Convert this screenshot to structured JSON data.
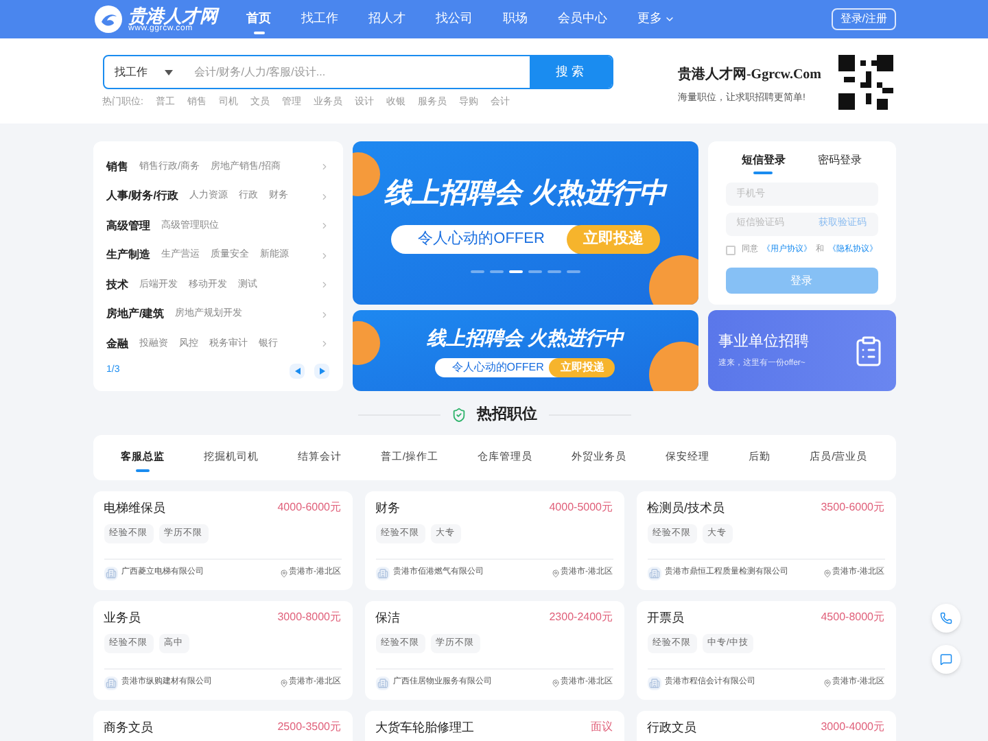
{
  "header": {
    "logo_name": "贵港人才网",
    "logo_url": "www.ggrcw.com",
    "nav": [
      {
        "label": "首页",
        "selected": true
      },
      {
        "label": "找工作",
        "selected": false
      },
      {
        "label": "招人才",
        "selected": false
      },
      {
        "label": "找公司",
        "selected": false
      },
      {
        "label": "职场",
        "selected": false
      },
      {
        "label": "会员中心",
        "selected": false
      },
      {
        "label": "更多",
        "selected": false,
        "dropdown": true
      }
    ],
    "login_button": "登录/注册"
  },
  "search": {
    "type_select": "找工作",
    "placeholder": "会计/财务/人力/客服/设计...",
    "button": "搜 索",
    "hot_label": "热门职位:",
    "hot": [
      "普工",
      "销售",
      "司机",
      "文员",
      "管理",
      "业务员",
      "设计",
      "收银",
      "服务员",
      "导购",
      "会计"
    ]
  },
  "brand": {
    "title": "贵港人才网-Ggrcw.Com",
    "slogan": "海量职位，让求职招聘更简单!"
  },
  "categories": {
    "items": [
      {
        "name": "销售",
        "subs": [
          "销售行政/商务",
          "房地产销售/招商"
        ]
      },
      {
        "name": "人事/财务/行政",
        "subs": [
          "人力资源",
          "行政",
          "财务"
        ]
      },
      {
        "name": "高级管理",
        "subs": [
          "高级管理职位"
        ]
      },
      {
        "name": "生产制造",
        "subs": [
          "生产营运",
          "质量安全",
          "新能源"
        ]
      },
      {
        "name": "技术",
        "subs": [
          "后端开发",
          "移动开发",
          "测试"
        ]
      },
      {
        "name": "房地产/建筑",
        "subs": [
          "房地产规划开发"
        ]
      },
      {
        "name": "金融",
        "subs": [
          "投融资",
          "风控",
          "税务审计",
          "银行"
        ]
      }
    ],
    "page": "1/3"
  },
  "banners": [
    {
      "headline": "线上招聘会 火热进行中",
      "tagline": "令人心动的OFFER",
      "cta": "立即投递",
      "dots": [
        {
          "selected": false
        },
        {
          "selected": false
        },
        {
          "selected": true
        },
        {
          "selected": false
        },
        {
          "selected": false
        },
        {
          "selected": false
        }
      ]
    },
    {
      "headline": "线上招聘会 火热进行中",
      "tagline": "令人心动的OFFER",
      "cta": "立即投递"
    }
  ],
  "login": {
    "tabs": [
      {
        "label": "短信登录",
        "selected": true
      },
      {
        "label": "密码登录",
        "selected": false
      }
    ],
    "phone_placeholder": "手机号",
    "code_placeholder": "短信验证码",
    "get_code": "获取验证码",
    "agree": {
      "checked": false,
      "prefix": "同意",
      "user_agreement": "《用户协议》",
      "and": "和",
      "privacy": "《隐私协议》"
    },
    "submit": "登录"
  },
  "promo": {
    "title": "事业单位招聘",
    "subtitle": "速来，这里有一份offer~"
  },
  "section_title": "热招职位",
  "job_tabs": [
    {
      "label": "客服总监",
      "selected": true
    },
    {
      "label": "挖掘机司机",
      "selected": false
    },
    {
      "label": "结算会计",
      "selected": false
    },
    {
      "label": "普工/操作工",
      "selected": false
    },
    {
      "label": "仓库管理员",
      "selected": false
    },
    {
      "label": "外贸业务员",
      "selected": false
    },
    {
      "label": "保安经理",
      "selected": false
    },
    {
      "label": "后勤",
      "selected": false
    },
    {
      "label": "店员/营业员",
      "selected": false
    }
  ],
  "jobs": [
    {
      "title": "电梯维保员",
      "salary": "4000-6000元",
      "tags": [
        "经验不限",
        "学历不限"
      ],
      "company": "广西菱立电梯有限公司",
      "location": "贵港市-港北区"
    },
    {
      "title": "财务",
      "salary": "4000-5000元",
      "tags": [
        "经验不限",
        "大专"
      ],
      "company": "贵港市佰港燃气有限公司",
      "location": "贵港市-港北区"
    },
    {
      "title": "检测员/技术员",
      "salary": "3500-6000元",
      "tags": [
        "经验不限",
        "大专"
      ],
      "company": "贵港市鼎恒工程质量检测有限公司",
      "location": "贵港市-港北区"
    },
    {
      "title": "业务员",
      "salary": "3000-8000元",
      "tags": [
        "经验不限",
        "高中"
      ],
      "company": "贵港市纵购建材有限公司",
      "location": "贵港市-港北区"
    },
    {
      "title": "保洁",
      "salary": "2300-2400元",
      "tags": [
        "经验不限",
        "学历不限"
      ],
      "company": "广西佳居物业服务有限公司",
      "location": "贵港市-港北区"
    },
    {
      "title": "开票员",
      "salary": "4500-8000元",
      "tags": [
        "经验不限",
        "中专/中技"
      ],
      "company": "贵港市程信会计有限公司",
      "location": "贵港市-港北区"
    },
    {
      "title": "商务文员",
      "salary": "2500-3500元"
    },
    {
      "title": "大货车轮胎修理工",
      "salary": "面议"
    },
    {
      "title": "行政文员",
      "salary": "3000-4000元"
    }
  ]
}
